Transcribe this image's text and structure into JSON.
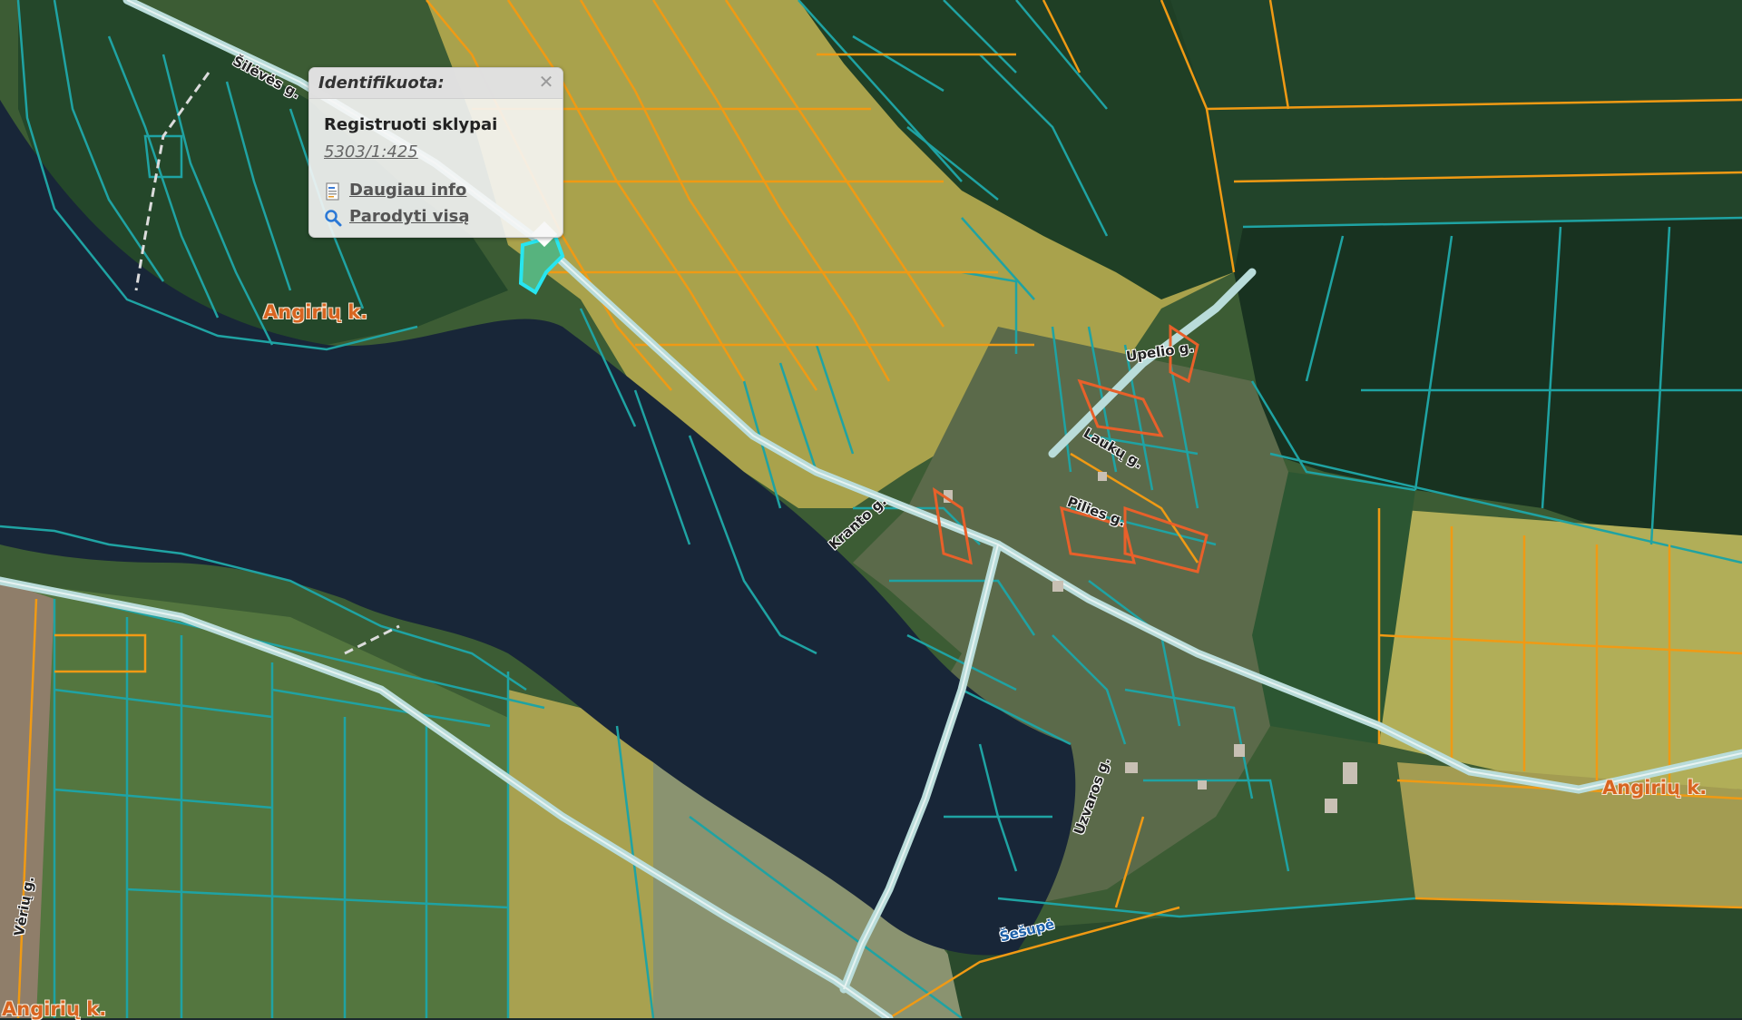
{
  "popup": {
    "title": "Identifikuota:",
    "close_glyph": "✕",
    "layer_name": "Registruoti sklypai",
    "parcel_id": "5303/1:425",
    "more_info": "Daugiau info",
    "show_all": "Parodyti visą",
    "more_info_icon": "document-icon",
    "show_all_icon": "magnifier-icon"
  },
  "labels": {
    "village_main": "Angirių k.",
    "village_east": "Angirių k.",
    "village_sw": "Angirių k.",
    "street_north": "Šilėvės g.",
    "street_kranto": "Kranto g.",
    "street_pilies": "Pilies g.",
    "street_upelio": "Upelio g.",
    "street_uzvaros": "Uzvaros g.",
    "street_lauku": "Laukų g.",
    "street_west": "Vėrių g.",
    "river": "Šešupė"
  },
  "colors": {
    "water": "#182638",
    "parcel_teal": "#1fa3a3",
    "parcel_orange": "#f09a14",
    "road": "#b9dcda",
    "selected_parcel": "#27e6f0",
    "field_yellow": "#a8a04a",
    "forest": "#1d3a22",
    "field_green": "#2f5a2c"
  }
}
